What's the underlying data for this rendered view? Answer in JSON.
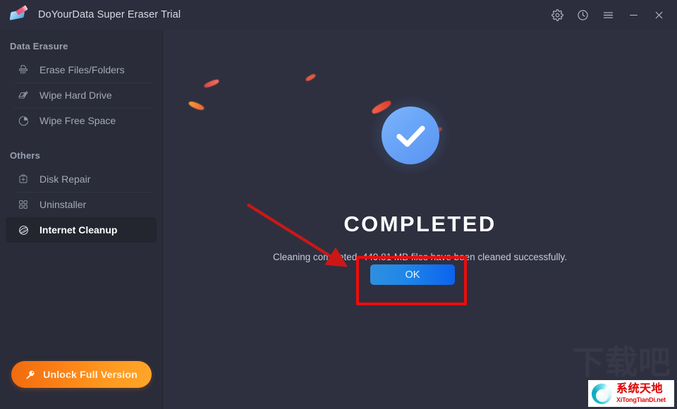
{
  "window": {
    "title": "DoYourData Super Eraser Trial",
    "logo_icon": "eraser-pen-logo",
    "controls": [
      {
        "name": "settings",
        "icon": "gear-icon"
      },
      {
        "name": "history",
        "icon": "clock-icon"
      },
      {
        "name": "menu",
        "icon": "hamburger-menu-icon"
      },
      {
        "name": "minimize",
        "icon": "minimize-icon"
      },
      {
        "name": "close",
        "icon": "close-icon"
      }
    ]
  },
  "sidebar": {
    "sections": [
      {
        "header": "Data Erasure",
        "items": [
          {
            "label": "Erase Files/Folders",
            "icon": "shredder-icon",
            "active": false
          },
          {
            "label": "Wipe Hard Drive",
            "icon": "hard-drive-pen-icon",
            "active": false
          },
          {
            "label": "Wipe Free Space",
            "icon": "pie-chart-icon",
            "active": false
          }
        ]
      },
      {
        "header": "Others",
        "items": [
          {
            "label": "Disk Repair",
            "icon": "first-aid-kit-icon",
            "active": false
          },
          {
            "label": "Uninstaller",
            "icon": "grid-squares-icon",
            "active": false
          },
          {
            "label": "Internet Cleanup",
            "icon": "globe-icon",
            "active": true
          }
        ]
      }
    ],
    "unlock_button": {
      "label": "Unlock Full Version",
      "icon": "key-icon",
      "color": "#fb8117"
    }
  },
  "main": {
    "status_icon": "checkmark-circle-icon",
    "status_color": "#6aa6f8",
    "heading": "COMPLETED",
    "message": "Cleaning completed. 449.81 MB files have been cleaned successfully.",
    "cleaned_size": "449.81 MB",
    "ok_button": {
      "label": "OK",
      "color": "#1f87e8"
    }
  },
  "annotations": {
    "highlight_color": "#ee0c0c",
    "box_target": "ok-button",
    "arrow_target": "ok-button"
  },
  "watermark": {
    "background_text": "下载吧",
    "chinese": "系统天地",
    "domain": "XiTongTianDi.net",
    "logo_icon": "circular-arrows-logo"
  }
}
